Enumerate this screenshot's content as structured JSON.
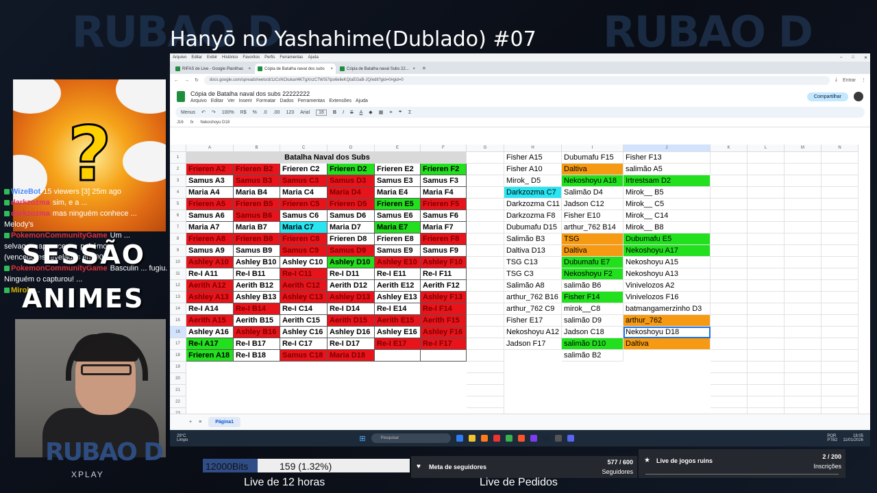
{
  "stream": {
    "title": "Hanyō no Yashahime(Dublado) #07",
    "logo": "RUBAO D",
    "logo_sub": "XPLAY",
    "overlay_line1": "SESSÃO",
    "overlay_line2": "ANIMES"
  },
  "chat": {
    "lines": [
      {
        "user": "WizeBot",
        "text": "15 viewers [3] 25m ago",
        "color": "#4b8bff"
      },
      {
        "user": "darkzozma",
        "text": "sim, e a ...",
        "color": "#d9346b"
      },
      {
        "user": "darkzozma",
        "text": "mas ninguém conhece ...",
        "color": "#d9346b"
      },
      {
        "user": "",
        "text": "Melody's",
        "color": "#fff"
      },
      {
        "user": "PokemonCommunityGame",
        "text": "Um ...",
        "color": "#e0313b"
      },
      {
        "user": "",
        "text": "selvagem apareceu ... pokémon",
        "color": "#fff"
      },
      {
        "user": "",
        "text": "(vencedores revelados em 90s)",
        "color": "#fff"
      },
      {
        "user": "PokemonCommunityGame",
        "text": "Basculin ... fugiu.",
        "color": "#e0313b"
      },
      {
        "user": "",
        "text": "Ninguém o capturou! ...",
        "color": "#fff"
      },
      {
        "user": "Mirok",
        "text": "...",
        "color": "#d9b400"
      }
    ]
  },
  "browser": {
    "menu": [
      "Arquivo",
      "Editar",
      "Exibir",
      "Histórico",
      "Favoritos",
      "Perfis",
      "Ferramentas",
      "Ajuda"
    ],
    "tabs": [
      "RIFAS de Live - Google Planilhas",
      "Cópia de Batalha naval dos subs",
      "Cópia de Batalha naval Subs 22..."
    ],
    "url": "docs.google.com/spreadsheets/d/1zCsNCkukarl4KTgXnzC7WSi7tpo6eileKQtaEGaB-JQ/edit?gid=0#gid=0",
    "enter_label": "Entrar"
  },
  "sheet": {
    "title": "Cópia de Batalha naval dos subs 22222222",
    "menu": [
      "Arquivo",
      "Editar",
      "Ver",
      "Inserir",
      "Formatar",
      "Dados",
      "Ferramentas",
      "Extensões",
      "Ajuda"
    ],
    "share_label": "Compartilhar",
    "toolbar": {
      "menus": "Menus",
      "zoom": "100%",
      "currency": "R$",
      "percent": "%",
      "dec1": ".0",
      "dec2": ".00",
      "format123": "123",
      "font": "Arial",
      "fontsize": "16"
    },
    "cellref": "J16",
    "formula": "Nekoshoyu D18",
    "columns": [
      "A",
      "B",
      "C",
      "D",
      "E",
      "F",
      "G",
      "H",
      "I",
      "J",
      "K",
      "L",
      "M",
      "N"
    ],
    "rows": [
      "1",
      "2",
      "3",
      "4",
      "5",
      "6",
      "7",
      "8",
      "9",
      "10",
      "11",
      "12",
      "13",
      "14",
      "15",
      "16",
      "17",
      "18",
      "19",
      "20",
      "21",
      "22",
      "23",
      "24"
    ],
    "header_title": "Batalha Naval dos Subs",
    "board": [
      [
        [
          "Frieren A2",
          "r"
        ],
        [
          "Frieren B2",
          "r"
        ],
        [
          "Frieren C2",
          "w"
        ],
        [
          "Frieren D2",
          "g"
        ],
        [
          "Frieren E2",
          "w"
        ],
        [
          "Frieren F2",
          "g"
        ]
      ],
      [
        [
          "Samus A3",
          "w"
        ],
        [
          "Samus B3",
          "r"
        ],
        [
          "Samus C3",
          "r"
        ],
        [
          "Samus D3",
          "r"
        ],
        [
          "Samus E3",
          "w"
        ],
        [
          "Samus F3",
          "w"
        ]
      ],
      [
        [
          "Maria A4",
          "w"
        ],
        [
          "Maria B4",
          "w"
        ],
        [
          "Maria C4",
          "w"
        ],
        [
          "Maria D4",
          "r"
        ],
        [
          "Maria E4",
          "w"
        ],
        [
          "Maria F4",
          "w"
        ]
      ],
      [
        [
          "Frieren A5",
          "r"
        ],
        [
          "Frieren B5",
          "r"
        ],
        [
          "Frieren C5",
          "r"
        ],
        [
          "Frieren D5",
          "r"
        ],
        [
          "Frieren E5",
          "g"
        ],
        [
          "Frieren F5",
          "r"
        ]
      ],
      [
        [
          "Samus A6",
          "w"
        ],
        [
          "Samus B6",
          "r"
        ],
        [
          "Samus C6",
          "w"
        ],
        [
          "Samus D6",
          "w"
        ],
        [
          "Samus E6",
          "w"
        ],
        [
          "Samus F6",
          "w"
        ]
      ],
      [
        [
          "Maria A7",
          "w"
        ],
        [
          "Maria B7",
          "w"
        ],
        [
          "Maria C7",
          "c"
        ],
        [
          "Maria D7",
          "w"
        ],
        [
          "Maria E7",
          "g"
        ],
        [
          "Maria F7",
          "w"
        ]
      ],
      [
        [
          "Frieren A8",
          "r"
        ],
        [
          "Frieren B8",
          "r"
        ],
        [
          "Frieren C8",
          "r"
        ],
        [
          "Frieren D8",
          "w"
        ],
        [
          "Frieren E8",
          "w"
        ],
        [
          "Frieren F8",
          "r"
        ]
      ],
      [
        [
          "Samus A9",
          "w"
        ],
        [
          "Samus B9",
          "w"
        ],
        [
          "Samus C9",
          "r"
        ],
        [
          "Samus D9",
          "r"
        ],
        [
          "Samus E9",
          "w"
        ],
        [
          "Samus F9",
          "w"
        ]
      ],
      [
        [
          "Ashley A10",
          "r"
        ],
        [
          "Ashley B10",
          "w"
        ],
        [
          "Ashley C10",
          "w"
        ],
        [
          "Ashley D10",
          "g"
        ],
        [
          "Ashley E10",
          "r"
        ],
        [
          "Ashley F10",
          "r"
        ]
      ],
      [
        [
          "Re-I A11",
          "w"
        ],
        [
          "Re-I B11",
          "w"
        ],
        [
          "Re-I C11",
          "r"
        ],
        [
          "Re-I D11",
          "w"
        ],
        [
          "Re-I E11",
          "w"
        ],
        [
          "Re-I F11",
          "w"
        ]
      ],
      [
        [
          "Aerith A12",
          "r"
        ],
        [
          "Aerith B12",
          "w"
        ],
        [
          "Aerith C12",
          "r"
        ],
        [
          "Aerith D12",
          "w"
        ],
        [
          "Aerith E12",
          "w"
        ],
        [
          "Aerith F12",
          "w"
        ]
      ],
      [
        [
          "Ashley A13",
          "r"
        ],
        [
          "Ashley B13",
          "w"
        ],
        [
          "Ashley C13",
          "r"
        ],
        [
          "Ashley D13",
          "r"
        ],
        [
          "Ashley E13",
          "w"
        ],
        [
          "Ashley F13",
          "r"
        ]
      ],
      [
        [
          "Re-I A14",
          "w"
        ],
        [
          "Re-I B14",
          "r"
        ],
        [
          "Re-I C14",
          "w"
        ],
        [
          "Re-I D14",
          "w"
        ],
        [
          "Re-I E14",
          "w"
        ],
        [
          "Re-I F14",
          "r"
        ]
      ],
      [
        [
          "Aerith A15",
          "r"
        ],
        [
          "Aerith B15",
          "w"
        ],
        [
          "Aerith C15",
          "w"
        ],
        [
          "Aerith D15",
          "r"
        ],
        [
          "Aerith E15",
          "r"
        ],
        [
          "Aerith F15",
          "r"
        ]
      ],
      [
        [
          "Ashley A16",
          "w"
        ],
        [
          "Ashley B16",
          "r"
        ],
        [
          "Ashley C16",
          "w"
        ],
        [
          "Ashley D16",
          "w"
        ],
        [
          "Ashley E16",
          "w"
        ],
        [
          "Ashley F16",
          "r"
        ]
      ],
      [
        [
          "Re-I A17",
          "g"
        ],
        [
          "Re-I B17",
          "w"
        ],
        [
          "Re-I C17",
          "w"
        ],
        [
          "Re-I D17",
          "w"
        ],
        [
          "Re-I E17",
          "r"
        ],
        [
          "Re-I F17",
          "r"
        ]
      ],
      [
        [
          "Frieren A18",
          "g"
        ],
        [
          "Re-I B18",
          "w"
        ],
        [
          "Samus C18",
          "r"
        ],
        [
          "Maria D18",
          "r"
        ],
        [
          "",
          "w"
        ],
        [
          "",
          "w"
        ]
      ]
    ],
    "col_h": [
      [
        "Fisher A15",
        ""
      ],
      [
        "Fisher A10",
        ""
      ],
      [
        "Mirok_ D5",
        ""
      ],
      [
        "Darkzozma C7",
        "c"
      ],
      [
        "Darkzozma C11",
        ""
      ],
      [
        "Darkzozma F8",
        ""
      ],
      [
        "Dubumafu D15",
        ""
      ],
      [
        "Salimão B3",
        ""
      ],
      [
        "Daltiva D13",
        ""
      ],
      [
        "TSG C13",
        ""
      ],
      [
        "TSG C3",
        ""
      ],
      [
        "Salimão A8",
        ""
      ],
      [
        "arthur_762 B16",
        ""
      ],
      [
        "arthur_762 C9",
        ""
      ],
      [
        "Fisher E17",
        ""
      ],
      [
        "Nekoshoyu A12",
        ""
      ],
      [
        "Jadson F17",
        ""
      ]
    ],
    "col_i": [
      [
        "Dubumafu F15",
        ""
      ],
      [
        "Daltiva",
        "o"
      ],
      [
        "Nekoshoyu A18",
        "g"
      ],
      [
        "Salimão D4",
        ""
      ],
      [
        "Jadson C12",
        ""
      ],
      [
        "Fisher E10",
        ""
      ],
      [
        "arthur_762 B14",
        ""
      ],
      [
        "TSG",
        "o"
      ],
      [
        "Daltiva",
        "o"
      ],
      [
        "Dubumafu E7",
        "g"
      ],
      [
        "Nekoshoyu F2",
        "g"
      ],
      [
        "salimão B6",
        ""
      ],
      [
        "Fisher F14",
        "g"
      ],
      [
        "mirok__C8",
        ""
      ],
      [
        "salimão D9",
        ""
      ],
      [
        "Jadson C18",
        ""
      ],
      [
        "salimão D10",
        "g"
      ],
      [
        "salimão B2",
        ""
      ]
    ],
    "col_j": [
      [
        "Fisher F13",
        ""
      ],
      [
        "salimão A5",
        ""
      ],
      [
        "Irtrestsam D2",
        "g"
      ],
      [
        "Mirok__ B5",
        ""
      ],
      [
        "Mirok__ C5",
        ""
      ],
      [
        "Mirok__ C14",
        ""
      ],
      [
        "Mirok__ B8",
        ""
      ],
      [
        "Dubumafu E5",
        "g"
      ],
      [
        "Nekoshoyu A17",
        "g"
      ],
      [
        "Nekoshoyu A15",
        ""
      ],
      [
        "Nekoshoyu A13",
        ""
      ],
      [
        "Vinivelozos A2",
        ""
      ],
      [
        "Vinivelozos F16",
        ""
      ],
      [
        "batmangamerzinho D3",
        ""
      ],
      [
        "arthur_762",
        "o"
      ],
      [
        "Nekoshoyu D18",
        "s"
      ],
      [
        "Daltiva",
        "o"
      ]
    ],
    "sheet_tab": "Página1"
  },
  "taskbar": {
    "weather_temp": "29°C",
    "weather_desc": "Limpo",
    "search": "Pesquisar",
    "lang": "POR",
    "lang2": "PTB2",
    "time": "18:05",
    "date": "11/01/2026"
  },
  "bottom": {
    "bits_label": "12000Bits",
    "bits_progress": "159 (1.32%)",
    "bits_fraction": 0.0132,
    "followers_label": "Meta de seguidores",
    "followers_count": "577 / 600",
    "followers_unit": "Seguidores",
    "subs_label": "Live de jogos ruins",
    "subs_count": "2 / 200",
    "subs_unit": "Inscrições",
    "caption_left": "Live  de 12 horas",
    "caption_right": "Live de Pedidos"
  },
  "colors": {
    "red": "#e8141b",
    "green": "#22e01e",
    "white": "#ffffff",
    "cyan": "#29e5f2",
    "orange": "#f59a12",
    "accent": "#1e8e3e"
  }
}
